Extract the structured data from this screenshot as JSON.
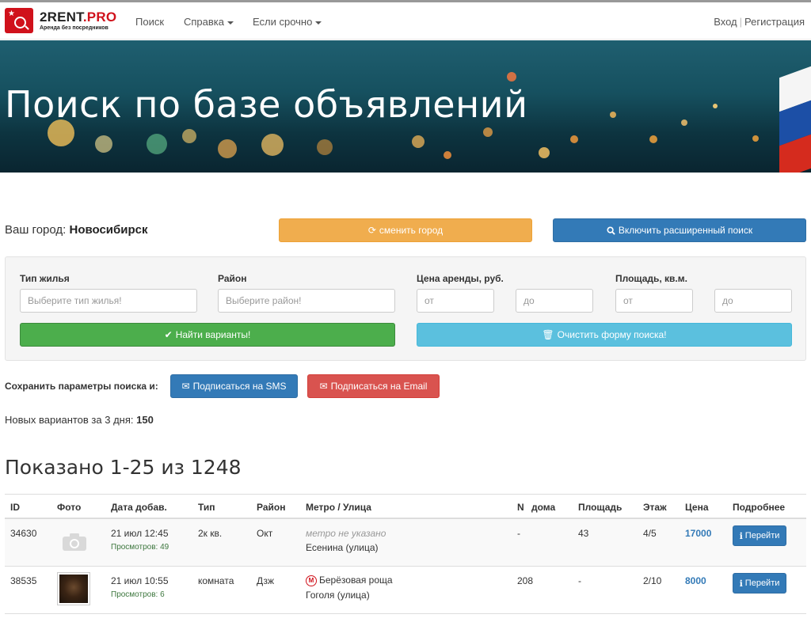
{
  "navbar": {
    "logo_title": "2RENT",
    "logo_dot": ".",
    "logo_tld": "PRO",
    "logo_sub": "Аренда без посредников",
    "links": [
      "Поиск",
      "Справка",
      "Если срочно"
    ],
    "login": "Вход",
    "register": "Регистрация"
  },
  "hero": {
    "title": "Поиск по базе объявлений"
  },
  "city": {
    "label": "Ваш город:",
    "name": "Новосибирск"
  },
  "buttons": {
    "change_city": "сменить город",
    "advanced": "Включить расширенный поиск",
    "find": "Найти варианты!",
    "clear": "Очистить форму поиска!",
    "sms": "Подписаться на SMS",
    "email": "Подписаться на Email",
    "go": "Перейти"
  },
  "form": {
    "type_label": "Тип жилья",
    "type_placeholder": "Выберите тип жилья!",
    "district_label": "Район",
    "district_placeholder": "Выберите район!",
    "price_label": "Цена аренды, руб.",
    "area_label": "Площадь, кв.м.",
    "from": "от",
    "to": "до"
  },
  "save_label": "Сохранить параметры поиска и:",
  "new_variants": {
    "label": "Новых вариантов за 3 дня:",
    "count": "150"
  },
  "shown": "Показано 1-25 из 1248",
  "table": {
    "headers": [
      "ID",
      "Фото",
      "Дата добав.",
      "Тип",
      "Район",
      "Метро / Улица",
      "N дома",
      "Площадь",
      "Этаж",
      "Цена",
      "Подробнее"
    ],
    "rows": [
      {
        "id": "34630",
        "date": "21 июл 12:45",
        "views": "Просмотров: 49",
        "type": "2к кв.",
        "district": "Окт",
        "metro": "метро не указано",
        "street": "Есенина (улица)",
        "house": "-",
        "area": "43",
        "floor": "4/5",
        "price": "17000"
      },
      {
        "id": "38535",
        "date": "21 июл 10:55",
        "views": "Просмотров: 6",
        "type": "комната",
        "district": "Дзж",
        "metro": "Берёзовая роща",
        "street": "Гоголя (улица)",
        "house": "208",
        "area": "-",
        "floor": "2/10",
        "price": "8000"
      }
    ]
  },
  "colors": {
    "brand": "#d0111b",
    "primary": "#337ab7",
    "success": "#4cae4c",
    "warning": "#f0ad4e",
    "info": "#5bc0de",
    "danger": "#d9534f"
  }
}
